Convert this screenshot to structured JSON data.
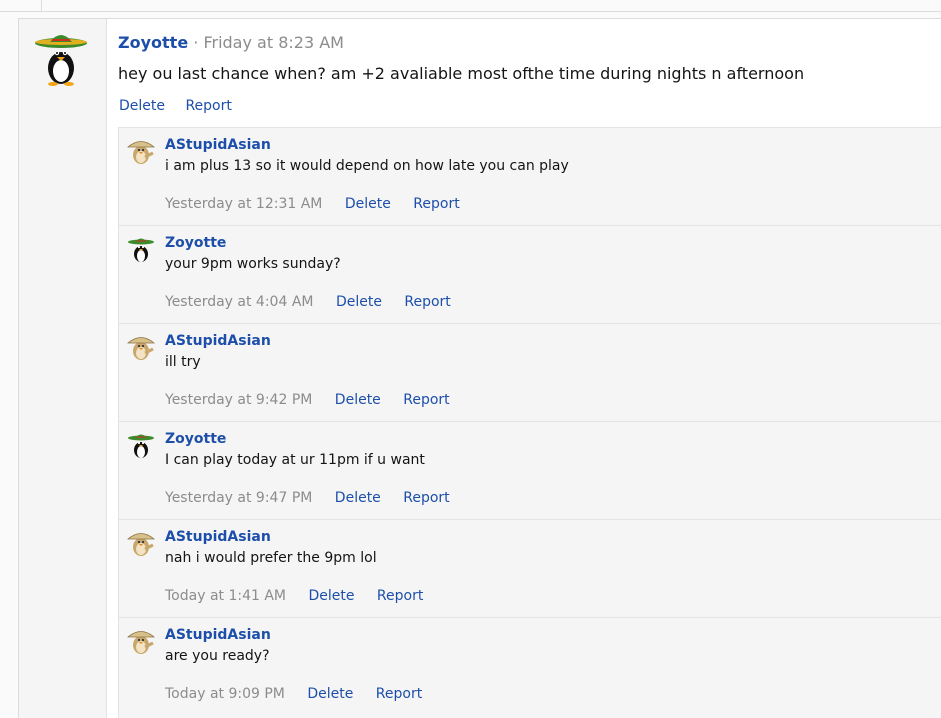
{
  "colors": {
    "link": "#1d4faa",
    "muted": "#8c8c8c",
    "text": "#141414"
  },
  "post": {
    "author": "Zoyotte",
    "separator": "·",
    "time": "Friday at 8:23 AM",
    "text": "hey ou last chance when? am +2 avaliable most ofthe time during nights n afternoon",
    "actions": {
      "delete": "Delete",
      "report": "Report"
    },
    "avatar_icon": "penguin-sombrero-icon"
  },
  "comments": [
    {
      "author": "AStupidAsian",
      "avatar_icon": "penguin-rice-hat-icon",
      "text": "i am plus 13 so it would depend on how late you can play",
      "time": "Yesterday at 12:31 AM",
      "delete": "Delete",
      "report": "Report"
    },
    {
      "author": "Zoyotte",
      "avatar_icon": "penguin-sombrero-icon",
      "text": "your 9pm works sunday?",
      "time": "Yesterday at 4:04 AM",
      "delete": "Delete",
      "report": "Report"
    },
    {
      "author": "AStupidAsian",
      "avatar_icon": "penguin-rice-hat-icon",
      "text": "ill try",
      "time": "Yesterday at 9:42 PM",
      "delete": "Delete",
      "report": "Report"
    },
    {
      "author": "Zoyotte",
      "avatar_icon": "penguin-sombrero-icon",
      "text": "I can play today at ur 11pm if u want",
      "time": "Yesterday at 9:47 PM",
      "delete": "Delete",
      "report": "Report"
    },
    {
      "author": "AStupidAsian",
      "avatar_icon": "penguin-rice-hat-icon",
      "text": "nah i would prefer the 9pm lol",
      "time": "Today at 1:41 AM",
      "delete": "Delete",
      "report": "Report"
    },
    {
      "author": "AStupidAsian",
      "avatar_icon": "penguin-rice-hat-icon",
      "text": "are you ready?",
      "time": "Today at 9:09 PM",
      "delete": "Delete",
      "report": "Report"
    }
  ]
}
